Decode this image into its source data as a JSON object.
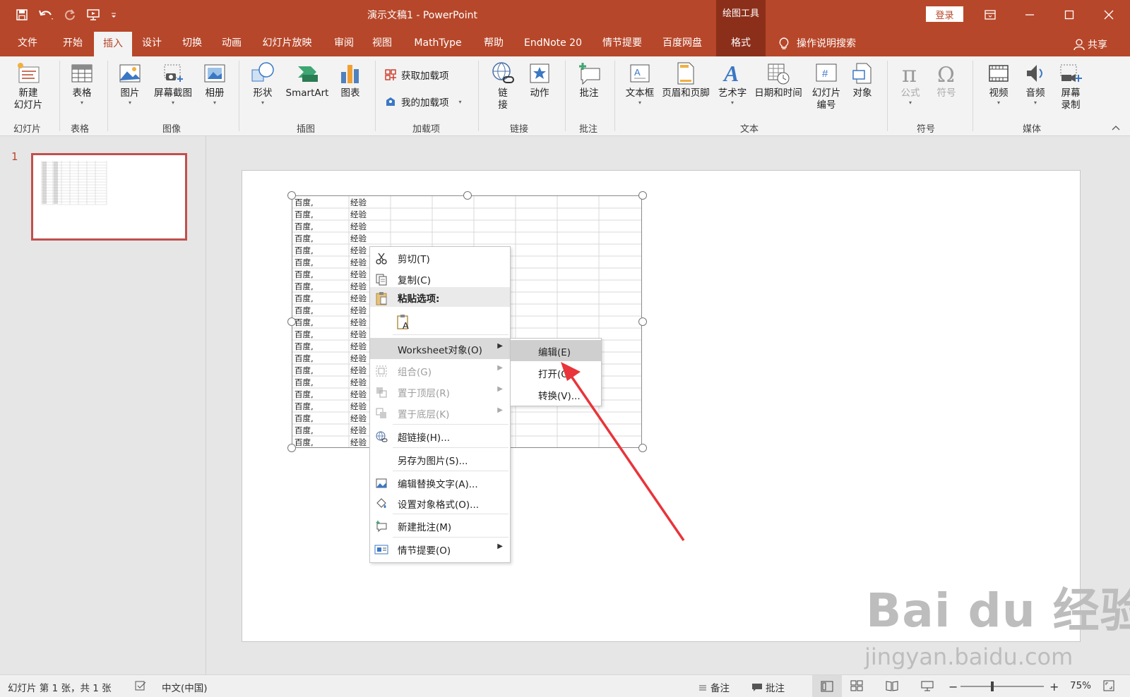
{
  "window": {
    "title": "演示文稿1 - PowerPoint",
    "context_tool_label": "绘图工具",
    "login_label": "登录",
    "share_label": "共享"
  },
  "tabs": [
    {
      "label": "文件"
    },
    {
      "label": "开始"
    },
    {
      "label": "插入",
      "active": true
    },
    {
      "label": "设计"
    },
    {
      "label": "切换"
    },
    {
      "label": "动画"
    },
    {
      "label": "幻灯片放映"
    },
    {
      "label": "审阅"
    },
    {
      "label": "视图"
    },
    {
      "label": "MathType"
    },
    {
      "label": "帮助"
    },
    {
      "label": "EndNote 20"
    },
    {
      "label": "情节提要"
    },
    {
      "label": "百度网盘"
    },
    {
      "label": "格式",
      "contextual": true
    },
    {
      "label": "操作说明搜索",
      "icon": "lightbulb-icon"
    }
  ],
  "ribbon": {
    "buttons": {
      "new_slide": "新建\n幻灯片",
      "table": "表格",
      "picture": "图片",
      "screenshot": "屏幕截图",
      "album": "相册",
      "shapes": "形状",
      "smartart": "SmartArt",
      "chart": "图表",
      "get_addins": "获取加载项",
      "my_addins": "我的加载项",
      "link": "链\n接",
      "action": "动作",
      "comment": "批注",
      "textbox": "文本框",
      "header_footer": "页眉和页脚",
      "wordart": "艺术字",
      "datetime": "日期和时间",
      "slide_number": "幻灯片\n编号",
      "object": "对象",
      "equation": "公式",
      "symbol": "符号",
      "video": "视频",
      "audio": "音频",
      "screen_record": "屏幕\n录制"
    },
    "groups": {
      "slides": "幻灯片",
      "tables": "表格",
      "images": "图像",
      "illustrations": "插图",
      "addins": "加载项",
      "links": "链接",
      "comments": "批注",
      "text": "文本",
      "symbols": "符号",
      "media": "媒体"
    }
  },
  "slides_pane": {
    "slide_number": "1"
  },
  "embedded_table": {
    "rows": [
      [
        "百度,",
        "经验"
      ],
      [
        "百度,",
        "经验"
      ],
      [
        "百度,",
        "经验"
      ],
      [
        "百度,",
        "经验"
      ],
      [
        "百度,",
        "经验"
      ],
      [
        "百度,",
        "经验"
      ],
      [
        "百度,",
        "经验"
      ],
      [
        "百度,",
        "经验"
      ],
      [
        "百度,",
        "经验"
      ],
      [
        "百度,",
        "经验"
      ],
      [
        "百度,",
        "经验"
      ],
      [
        "百度,",
        "经验"
      ],
      [
        "百度,",
        "经验"
      ],
      [
        "百度,",
        "经验"
      ],
      [
        "百度,",
        "经验"
      ],
      [
        "百度,",
        "经验"
      ],
      [
        "百度,",
        "经验"
      ],
      [
        "百度,",
        "经验"
      ],
      [
        "百度,",
        "经验"
      ],
      [
        "百度,",
        "经验"
      ],
      [
        "百度,",
        "经验"
      ]
    ]
  },
  "context_menu": {
    "items": [
      {
        "label": "剪切(T)",
        "icon": "scissors-icon"
      },
      {
        "label": "复制(C)",
        "icon": "copy-icon"
      },
      {
        "label": "粘贴选项:",
        "icon": "clipboard-icon",
        "header": true
      },
      {
        "label": "",
        "icon": "paste-keep-text-icon"
      },
      {
        "label": "Worksheet对象(O)",
        "submenu": true,
        "highlighted": true
      },
      {
        "label": "组合(G)",
        "icon": "group-icon",
        "disabled": true,
        "submenu": true
      },
      {
        "label": "置于顶层(R)",
        "icon": "bring-front-icon",
        "disabled": true,
        "submenu": true
      },
      {
        "label": "置于底层(K)",
        "icon": "send-back-icon",
        "disabled": true,
        "submenu": true
      },
      {
        "label": "超链接(H)...",
        "icon": "globe-link-icon"
      },
      {
        "label": "另存为图片(S)..."
      },
      {
        "label": "编辑替换文字(A)...",
        "icon": "image-alt-icon"
      },
      {
        "label": "设置对象格式(O)...",
        "icon": "format-paint-icon"
      },
      {
        "label": "新建批注(M)",
        "icon": "comment-icon"
      },
      {
        "label": "情节提要(O)",
        "icon": "storyboard-icon",
        "submenu": true
      }
    ],
    "submenu": [
      {
        "label": "编辑(E)",
        "highlighted": true
      },
      {
        "label": "打开(O)"
      },
      {
        "label": "转换(V)..."
      }
    ]
  },
  "watermark": {
    "logo": "Bai du 经验",
    "url": "jingyan.baidu.com"
  },
  "statusbar": {
    "slide_info": "幻灯片 第 1 张，共 1 张",
    "language": "中文(中国)",
    "notes": "备注",
    "comments": "批注",
    "zoom": "75%"
  },
  "colors": {
    "accent": "#b7472a",
    "context_tab": "#8b2f1a",
    "annotation_arrow": "#e8343a"
  }
}
